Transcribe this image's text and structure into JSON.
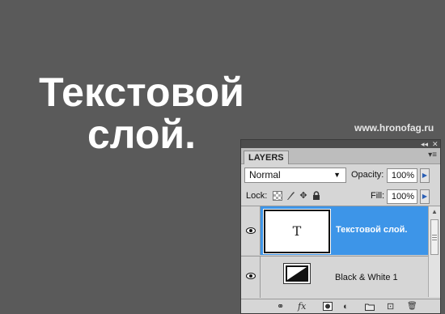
{
  "canvas": {
    "line1": "Текстовой",
    "line2": "слой.",
    "watermark": "www.hronofag.ru"
  },
  "panel": {
    "tab_label": "LAYERS",
    "blend_mode": "Normal",
    "opacity_label": "Opacity:",
    "opacity_value": "100%",
    "lock_label": "Lock:",
    "fill_label": "Fill:",
    "fill_value": "100%",
    "layers": [
      {
        "name": "Текстовой слой.",
        "thumb_glyph": "T",
        "selected": true,
        "visible": true
      },
      {
        "name": "Black & White 1",
        "selected": false,
        "visible": true
      }
    ],
    "bottom_icons": [
      "link-icon",
      "fx-icon",
      "mask-icon",
      "adjustment-icon",
      "group-icon",
      "new-layer-icon",
      "trash-icon"
    ],
    "bottom_glyphs": {
      "link": "⚭",
      "fx": "fx",
      "adjustment": "◐",
      "new_layer": "⊡",
      "trash": "🗑"
    },
    "colors": {
      "selection": "#3d95e8",
      "canvas_bg": "#5a5a5a"
    }
  }
}
